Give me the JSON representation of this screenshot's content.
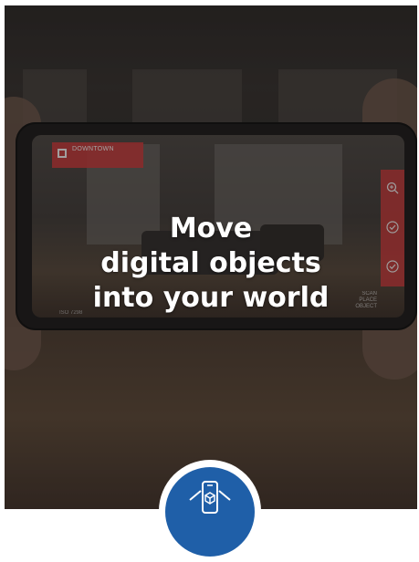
{
  "headline": {
    "line1": "Move",
    "line2": "digital objects",
    "line3": "into your world"
  },
  "screen_overlay": {
    "tag_title": "DOWNTOWN",
    "tag_subtitle": "",
    "bottom_left": "ISO 7298",
    "bottom_right_line1": "SCAN",
    "bottom_right_line2": "PLACE",
    "bottom_right_line3": "OBJECT"
  },
  "icons": {
    "zoom": "zoom-icon",
    "check1": "check-icon",
    "check2": "check-icon",
    "badge": "ar-phone-icon"
  },
  "colors": {
    "accent_red": "#c73a3a",
    "badge_blue": "#1f5fa8"
  }
}
